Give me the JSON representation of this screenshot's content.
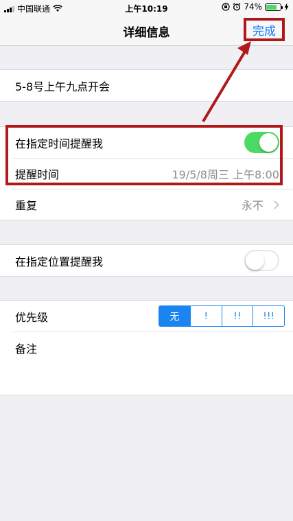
{
  "status_bar": {
    "carrier": "中国联通",
    "time": "上午10:19",
    "battery_percent": "74%",
    "battery_level": 0.74,
    "wifi_icon": "wifi-icon",
    "lock_icon": "rotation-lock-icon",
    "alarm_icon": "alarm-icon",
    "charging_icon": "charging-bolt-icon"
  },
  "nav": {
    "title": "详细信息",
    "done_label": "完成"
  },
  "reminder": {
    "title": "5-8号上午九点开会"
  },
  "time_section": {
    "remind_at_time_label": "在指定时间提醒我",
    "remind_at_time_on": true,
    "alarm_label": "提醒时间",
    "alarm_value": "19/5/8周三 上午8:00",
    "repeat_label": "重复",
    "repeat_value": "永不"
  },
  "location_section": {
    "remind_at_location_label": "在指定位置提醒我",
    "remind_at_location_on": false
  },
  "priority_section": {
    "priority_label": "优先级",
    "options": [
      "无",
      "!",
      "!!",
      "!!!"
    ],
    "selected_index": 0,
    "notes_label": "备注"
  },
  "colors": {
    "accent": "#0a7aff",
    "toggle_on": "#4cd964",
    "highlight": "#b0181a",
    "segment": "#1a84f0"
  }
}
